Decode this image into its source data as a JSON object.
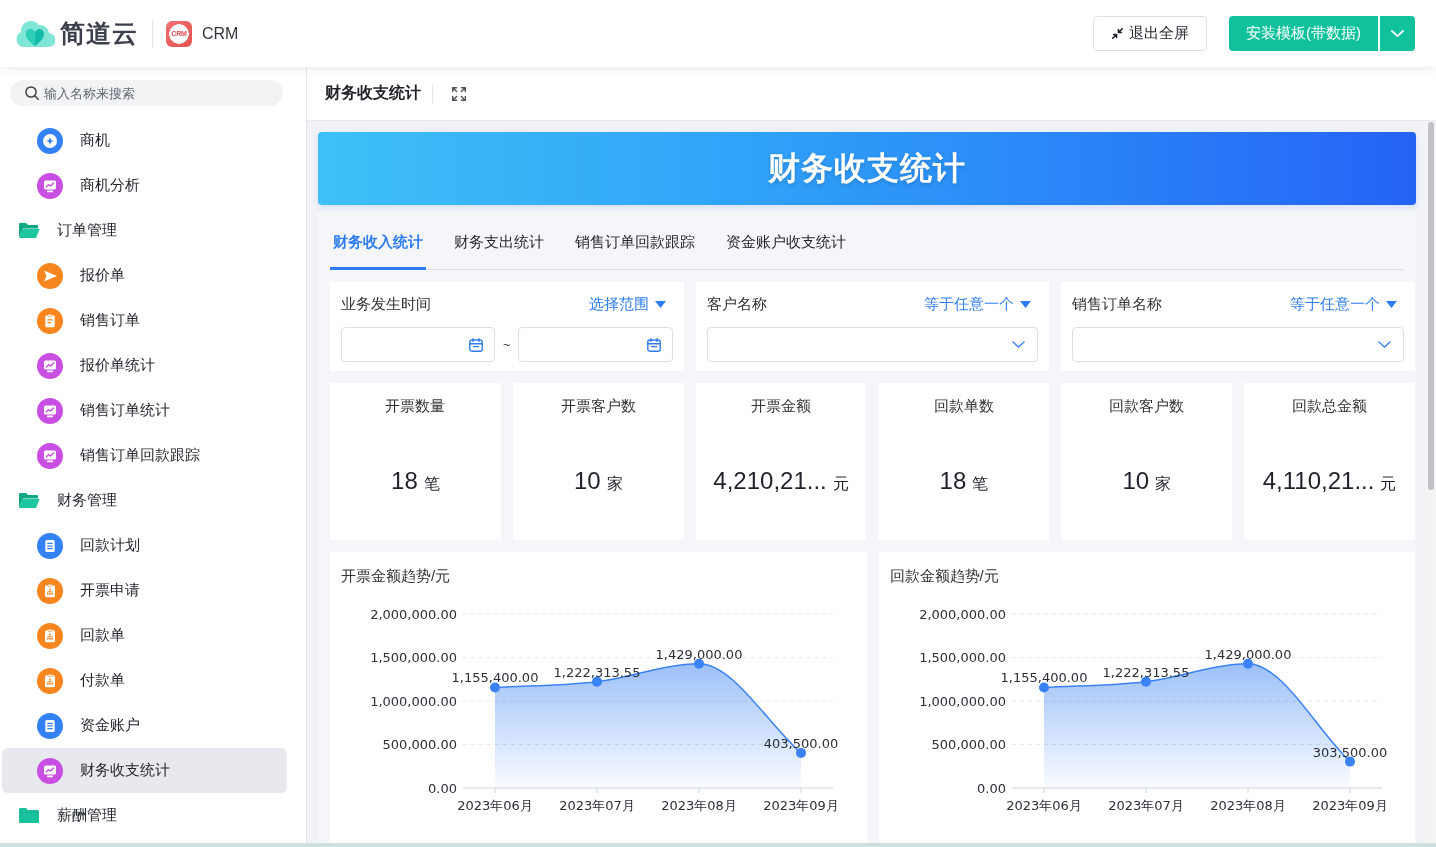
{
  "header": {
    "logo_text": "简道云",
    "app": {
      "badge": "CRM",
      "name": "CRM"
    },
    "buttons": [
      {
        "kind": "outline",
        "label": "退出全屏"
      },
      {
        "kind": "split",
        "label": "安装模板(带数据)"
      }
    ]
  },
  "sidebar": {
    "search": {
      "placeholder": "输入名称来搜索"
    },
    "items": [
      {
        "label": "商机",
        "kind": "target",
        "color": "#3480f5",
        "selected": false
      },
      {
        "label": "商机分析",
        "kind": "dashboard",
        "color": "#c84fe2",
        "selected": false
      },
      {
        "label": "订单管理",
        "kind": "folder",
        "expanded": true,
        "selected": false,
        "children": [
          {
            "label": "报价单",
            "kind": "send",
            "color": "#f8851e",
            "selected": false
          },
          {
            "label": "销售订单",
            "kind": "clipboard",
            "color": "#f8851e",
            "selected": false
          },
          {
            "label": "报价单统计",
            "kind": "dashboard",
            "color": "#c84fe2",
            "selected": false
          },
          {
            "label": "销售订单统计",
            "kind": "dashboard",
            "color": "#c84fe2",
            "selected": false
          },
          {
            "label": "销售订单回款跟踪",
            "kind": "dashboard",
            "color": "#c84fe2",
            "selected": false
          }
        ]
      },
      {
        "label": "财务管理",
        "kind": "folder",
        "expanded": true,
        "selected": false,
        "children": [
          {
            "label": "回款计划",
            "kind": "form",
            "color": "#3480f5",
            "selected": false
          },
          {
            "label": "开票申请",
            "kind": "workflow",
            "color": "#f8851e",
            "selected": false
          },
          {
            "label": "回款单",
            "kind": "workflow",
            "color": "#f8851e",
            "selected": false
          },
          {
            "label": "付款单",
            "kind": "workflow",
            "color": "#f8851e",
            "selected": false
          },
          {
            "label": "资金账户",
            "kind": "form",
            "color": "#3480f5",
            "selected": false
          },
          {
            "label": "财务收支统计",
            "kind": "dashboard",
            "color": "#c84fe2",
            "selected": true
          }
        ]
      },
      {
        "label": "薪酬管理",
        "kind": "folder",
        "expanded": false,
        "selected": false
      }
    ]
  },
  "page": {
    "title": "财务收支统计"
  },
  "banner": {
    "title": "财务收支统计"
  },
  "tabs": [
    {
      "label": "财务收入统计",
      "selected": true
    },
    {
      "label": "财务支出统计",
      "selected": false
    },
    {
      "label": "销售订单回款跟踪",
      "selected": false
    },
    {
      "label": "资金账户收支统计",
      "selected": false
    }
  ],
  "filters": [
    {
      "kind": "date_range",
      "label": "业务发生时间",
      "mode": "选择范围",
      "separator": "~"
    },
    {
      "kind": "select",
      "label": "客户名称",
      "mode": "等于任意一个"
    },
    {
      "kind": "select",
      "label": "销售订单名称",
      "mode": "等于任意一个"
    }
  ],
  "stats": [
    {
      "label": "开票数量",
      "value": "18",
      "unit": "笔"
    },
    {
      "label": "开票客户数",
      "value": "10",
      "unit": "家"
    },
    {
      "label": "开票金额",
      "value": "4,210,21...",
      "unit": "元"
    },
    {
      "label": "回款单数",
      "value": "18",
      "unit": "笔"
    },
    {
      "label": "回款客户数",
      "value": "10",
      "unit": "家"
    },
    {
      "label": "回款总金额",
      "value": "4,110,21...",
      "unit": "元"
    }
  ],
  "charts": [
    {
      "chart_data": {
        "type": "area",
        "title": "开票金额趋势/元",
        "categories": [
          "2023年06月",
          "2023年07月",
          "2023年08月",
          "2023年09月"
        ],
        "series": [
          {
            "color": "#3b82f6",
            "values": [
              1155400,
              1222313.55,
              1429000,
              403500
            ]
          }
        ],
        "ylim": [
          0,
          2000000
        ],
        "yticks": [
          {
            "value": 0,
            "label": "0.00"
          },
          {
            "value": 500000,
            "label": "500,000.00"
          },
          {
            "value": 1000000,
            "label": "1,000,000.00"
          },
          {
            "value": 1500000,
            "label": "1,500,000.00"
          },
          {
            "value": 2000000,
            "label": "2,000,000.00"
          }
        ],
        "grid": true,
        "value_labels": [
          "1,155,400.00",
          "1,222,313.55",
          "1,429,000.00",
          "403,500.00"
        ]
      }
    },
    {
      "chart_data": {
        "type": "area",
        "title": "回款金额趋势/元",
        "categories": [
          "2023年06月",
          "2023年07月",
          "2023年08月",
          "2023年09月"
        ],
        "series": [
          {
            "color": "#3b82f6",
            "values": [
              1155400,
              1222313.55,
              1429000,
              303500
            ]
          }
        ],
        "ylim": [
          0,
          2000000
        ],
        "yticks": [
          {
            "value": 0,
            "label": "0.00"
          },
          {
            "value": 500000,
            "label": "500,000.00"
          },
          {
            "value": 1000000,
            "label": "1,000,000.00"
          },
          {
            "value": 1500000,
            "label": "1,500,000.00"
          },
          {
            "value": 2000000,
            "label": "2,000,000.00"
          }
        ],
        "grid": true,
        "value_labels": [
          "1,155,400.00",
          "1,222,313.55",
          "1,429,000.00",
          "303,500.00"
        ]
      }
    }
  ]
}
